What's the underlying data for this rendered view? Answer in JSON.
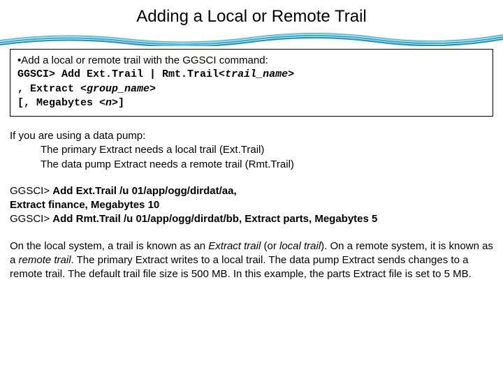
{
  "title": "Adding a Local or Remote Trail",
  "box": {
    "bullet": "• ",
    "intro": "Add a local or remote trail with the GGSCI command:",
    "l1_prompt": "GGSCI> ",
    "l1_cmd_a": "Add Ext.Trail | Rmt.Trail<",
    "l1_cmd_trail": "trail_name",
    "l1_cmd_b": ">",
    "l2_a": ", Extract <",
    "l2_grp": "group_name",
    "l2_b": ">",
    "l3_a": "[, Megabytes <",
    "l3_n": "n",
    "l3_b": ">]"
  },
  "pump": {
    "l1": "If you are using a data pump:",
    "l2": "The primary Extract needs a local trail  (Ext.Trail)",
    "l3": "The data pump Extract needs a remote trail  (Rmt.Trail)"
  },
  "cmds": {
    "l1": "GGSCI> ",
    "l1b": "Add Ext.Trail /u 01/app/ogg/dirdat/aa,",
    "l2": "Extract finance, Megabytes 10",
    "l3a": "GGSCI> ",
    "l3b": "Add Rmt.Trail /u 01/app/ogg/dirdat/bb, Extract parts, Megabytes 5"
  },
  "para": {
    "p1": "On the local system, a trail is known as an ",
    "p2": "Extract trail ",
    "p3": "(or ",
    "p4": "local trail",
    "p5": "). On a remote system, it is known as a ",
    "p6": "remote trail",
    "p7": ". The primary Extract writes to a local trail. The data pump Extract sends changes to a remote trail. The default trail file size is 500 MB. In this example, the parts Extract file is set to 5 MB."
  }
}
